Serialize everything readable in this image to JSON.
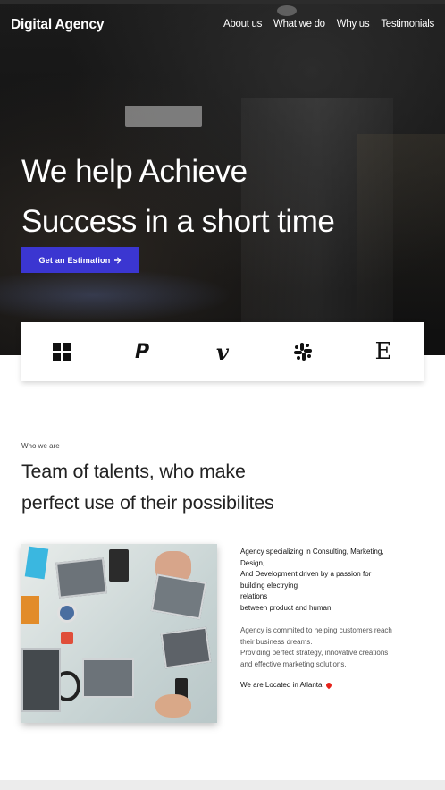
{
  "header": {
    "brand": "Digital Agency",
    "nav": [
      "About us",
      "What we do",
      "Why us",
      "Testimonials"
    ]
  },
  "hero": {
    "line1": "We help Achieve",
    "line2": "Success in a short time",
    "cta_label": "Get an Estimation",
    "cta_icon": "arrow-right-icon",
    "cta_color": "#3b36d1"
  },
  "logos": [
    {
      "name": "microsoft-logo-icon"
    },
    {
      "name": "paypal-logo-icon",
      "glyph": "P"
    },
    {
      "name": "vimeo-logo-icon",
      "glyph": "v"
    },
    {
      "name": "slack-logo-icon"
    },
    {
      "name": "etsy-logo-icon",
      "glyph": "E"
    }
  ],
  "about": {
    "kicker": "Who we are",
    "title_line1": "Team of talents, who make",
    "title_line2": "perfect use of their possibilites",
    "desc_lines": [
      "Agency specializing in Consulting, Marketing,",
      "Design,",
      "And Development driven by a passion for",
      "building electrying",
      "relations",
      "between product and human"
    ],
    "desc2_lines": [
      "Agency is commited to helping customers reach",
      "their business dreams.",
      "Providing perfect strategy, innovative creations",
      "and effective marketing solutions."
    ],
    "location": "We are Located in Atlanta",
    "location_icon": "map-pin-icon",
    "pin_color": "#e5231b"
  }
}
